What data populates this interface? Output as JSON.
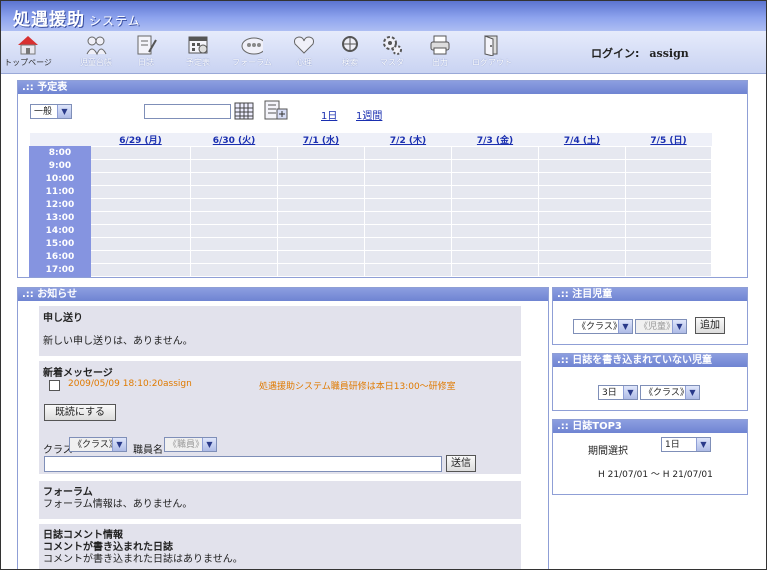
{
  "header": {
    "app_title": "処遇援助",
    "app_subtitle": "システム"
  },
  "toolbar": {
    "items": [
      {
        "label": "トップページ",
        "icon": "house-icon"
      },
      {
        "label": "児童台帳",
        "icon": "children-icon"
      },
      {
        "label": "日誌",
        "icon": "diary-icon"
      },
      {
        "label": "予定表",
        "icon": "calendar-icon"
      },
      {
        "label": "フォーラム",
        "icon": "forum-icon"
      },
      {
        "label": "心理",
        "icon": "heart-icon"
      },
      {
        "label": "検索",
        "icon": "search-icon"
      },
      {
        "label": "マスタ",
        "icon": "gear-icon"
      },
      {
        "label": "出力",
        "icon": "printer-icon"
      },
      {
        "label": "ログアウト",
        "icon": "door-icon"
      }
    ]
  },
  "login": {
    "label": "ログイン:",
    "user": "assign"
  },
  "schedule": {
    "title": ".:: 予定表",
    "category_select": "一般",
    "date_input": "",
    "link_1day": "1日",
    "link_1week": "1週間",
    "days": [
      "6/29 (月)",
      "6/30 (火)",
      "7/1 (水)",
      "7/2 (木)",
      "7/3 (金)",
      "7/4 (土)",
      "7/5 (日)"
    ],
    "hours": [
      "8:00",
      "9:00",
      "10:00",
      "11:00",
      "12:00",
      "13:00",
      "14:00",
      "15:00",
      "16:00",
      "17:00"
    ]
  },
  "notice": {
    "title": ".:: お知らせ",
    "handover_title": "申し送り",
    "handover_text": "新しい申し送りは、ありません。",
    "messages_title": "新着メッセージ",
    "message": {
      "date": "2009/05/09 18:10:20",
      "sender": "assign",
      "body": "処遇援助システム職員研修は本日13:00〜研修室"
    },
    "read_button": "既読にする",
    "class_label": "クラス",
    "class_select": "《クラス》",
    "staff_label": "職員名",
    "staff_select": "《職員》",
    "message_input": "",
    "send_button": "送信",
    "forum_title": "フォーラム",
    "forum_text": "フォーラム情報は、ありません。",
    "diary_comment_title": "日誌コメント情報",
    "diary_comment_sub": "コメントが書き込まれた日誌",
    "diary_comment_text": "コメントが書き込まれた日誌はありません。"
  },
  "attention": {
    "title": ".:: 注目児童",
    "class_select": "《クラス》",
    "child_select": "《児童》",
    "add_button": "追加"
  },
  "unwritten": {
    "title": ".:: 日誌を書き込まれていない児童",
    "days_select": "3日",
    "class_select": "《クラス》"
  },
  "top3": {
    "title": ".:: 日誌TOP3",
    "period_label": "期間選択",
    "period_select": "1日",
    "range": "H 21/07/01 〜 H 21/07/01"
  }
}
